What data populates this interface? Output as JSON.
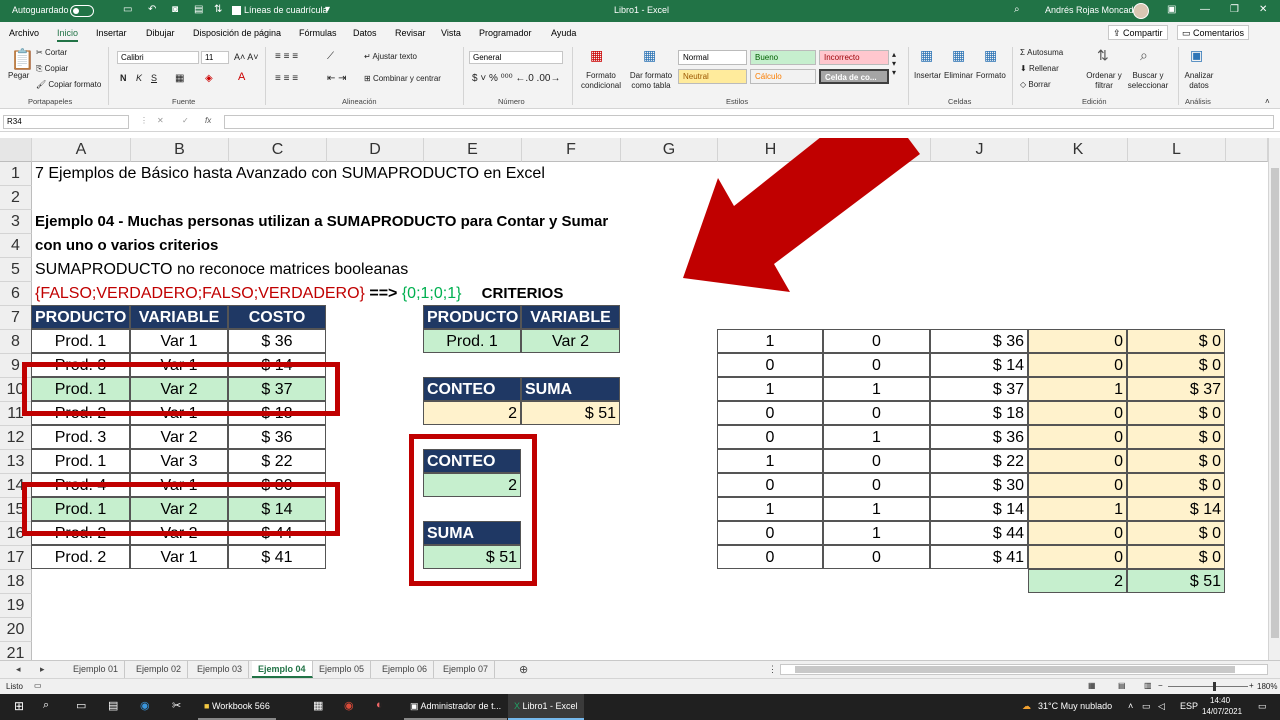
{
  "titlebar": {
    "autosave": "Autoguardado",
    "gridlines": "Líneas de cuadrícula",
    "doc_title": "Libro1 - Excel",
    "user": "Andrés Rojas Moncada"
  },
  "menu": [
    "Archivo",
    "Inicio",
    "Insertar",
    "Dibujar",
    "Disposición de página",
    "Fórmulas",
    "Datos",
    "Revisar",
    "Vista",
    "Programador",
    "Ayuda"
  ],
  "share": "Compartir",
  "comments": "Comentarios",
  "ribbon": {
    "paste": "Pegar",
    "cut": "Cortar",
    "copy": "Copiar",
    "format_painter": "Copiar formato",
    "clipboard": "Portapapeles",
    "font_name": "Calibri",
    "font_size": "11",
    "bold": "N",
    "italic": "K",
    "underline": "S",
    "font_group": "Fuente",
    "wrap": "Ajustar texto",
    "merge": "Combinar y centrar",
    "align_group": "Alineación",
    "number_format": "General",
    "number_group": "Número",
    "cond_format": "Formato condicional",
    "format_table": "Dar formato como tabla",
    "style_normal": "Normal",
    "style_good": "Bueno",
    "style_bad": "Incorrecto",
    "style_neutral": "Neutral",
    "style_calc": "Cálculo",
    "style_cell": "Celda de co...",
    "styles_group": "Estilos",
    "insert": "Insertar",
    "delete": "Eliminar",
    "format": "Formato",
    "cells_group": "Celdas",
    "autosum": "Autosuma",
    "fill": "Rellenar",
    "clear": "Borrar",
    "sort": "Ordenar y filtrar",
    "find": "Buscar y seleccionar",
    "edit_group": "Edición",
    "analyze": "Analizar datos",
    "analysis_group": "Análisis"
  },
  "formula_bar": {
    "name_box": "R34",
    "formula": ""
  },
  "columns": [
    "A",
    "B",
    "C",
    "D",
    "E",
    "F",
    "G",
    "H",
    "I",
    "J",
    "K",
    "L"
  ],
  "rows": [
    "1",
    "2",
    "3",
    "4",
    "5",
    "6",
    "7",
    "8",
    "9",
    "10",
    "11",
    "12",
    "13",
    "14",
    "15",
    "16",
    "17",
    "18",
    "19",
    "20",
    "21"
  ],
  "sheet": {
    "title": "7 Ejemplos de Básico hasta Avanzado con SUMAPRODUCTO en Excel",
    "heading1": "Ejemplo 04 - Muchas personas utilizan a SUMAPRODUCTO para Contar y Sumar",
    "heading2": "con uno o varios criterios",
    "note": "SUMAPRODUCTO no reconoce matrices booleanas",
    "bool_array": "{FALSO;VERDADERO;FALSO;VERDADERO}",
    "arrow": "==>",
    "num_array": "{0;1;0;1}",
    "criterios": "CRITERIOS",
    "hdr_producto": "PRODUCTO",
    "hdr_variable": "VARIABLE",
    "hdr_costo": "COSTO",
    "crit_producto": "Prod. 1",
    "crit_variable": "Var 2",
    "hdr_conteo": "CONTEO",
    "hdr_suma": "SUMA",
    "conteo": "2",
    "suma": "$ 51",
    "data": [
      [
        "Prod. 1",
        "Var 1",
        "$ 36"
      ],
      [
        "Prod. 3",
        "Var 1",
        "$ 14"
      ],
      [
        "Prod. 1",
        "Var 2",
        "$ 37"
      ],
      [
        "Prod. 2",
        "Var 1",
        "$ 18"
      ],
      [
        "Prod. 3",
        "Var 2",
        "$ 36"
      ],
      [
        "Prod. 1",
        "Var 3",
        "$ 22"
      ],
      [
        "Prod. 4",
        "Var 1",
        "$ 30"
      ],
      [
        "Prod. 1",
        "Var 2",
        "$ 14"
      ],
      [
        "Prod. 2",
        "Var 2",
        "$ 44"
      ],
      [
        "Prod. 2",
        "Var 1",
        "$ 41"
      ]
    ],
    "helper": [
      [
        "1",
        "0",
        "$ 36",
        "0",
        "$ 0"
      ],
      [
        "0",
        "0",
        "$ 14",
        "0",
        "$ 0"
      ],
      [
        "1",
        "1",
        "$ 37",
        "1",
        "$ 37"
      ],
      [
        "0",
        "0",
        "$ 18",
        "0",
        "$ 0"
      ],
      [
        "0",
        "1",
        "$ 36",
        "0",
        "$ 0"
      ],
      [
        "1",
        "0",
        "$ 22",
        "0",
        "$ 0"
      ],
      [
        "0",
        "0",
        "$ 30",
        "0",
        "$ 0"
      ],
      [
        "1",
        "1",
        "$ 14",
        "1",
        "$ 14"
      ],
      [
        "0",
        "1",
        "$ 44",
        "0",
        "$ 0"
      ],
      [
        "0",
        "0",
        "$ 41",
        "0",
        "$ 0"
      ]
    ],
    "helper_total_count": "2",
    "helper_total_sum": "$ 51"
  },
  "sheet_tabs": [
    "Ejemplo 01",
    "Ejemplo 02",
    "Ejemplo 03",
    "Ejemplo 04",
    "Ejemplo 05",
    "Ejemplo 06",
    "Ejemplo 07"
  ],
  "active_tab": "Ejemplo 04",
  "status": {
    "ready": "Listo",
    "zoom": "180%"
  },
  "taskbar": {
    "apps": [
      "Workbook 566",
      "Administrador de t...",
      "Libro1 - Excel"
    ],
    "weather": "31°C  Muy nublado",
    "lang": "ESP",
    "time": "14:40",
    "date": "14/07/2021"
  },
  "colors": {
    "excel_green": "#217346",
    "header_navy": "#1f3864",
    "highlight_green": "#c6efce",
    "highlight_yellow": "#fff2cc",
    "annotation_red": "#c00000"
  }
}
